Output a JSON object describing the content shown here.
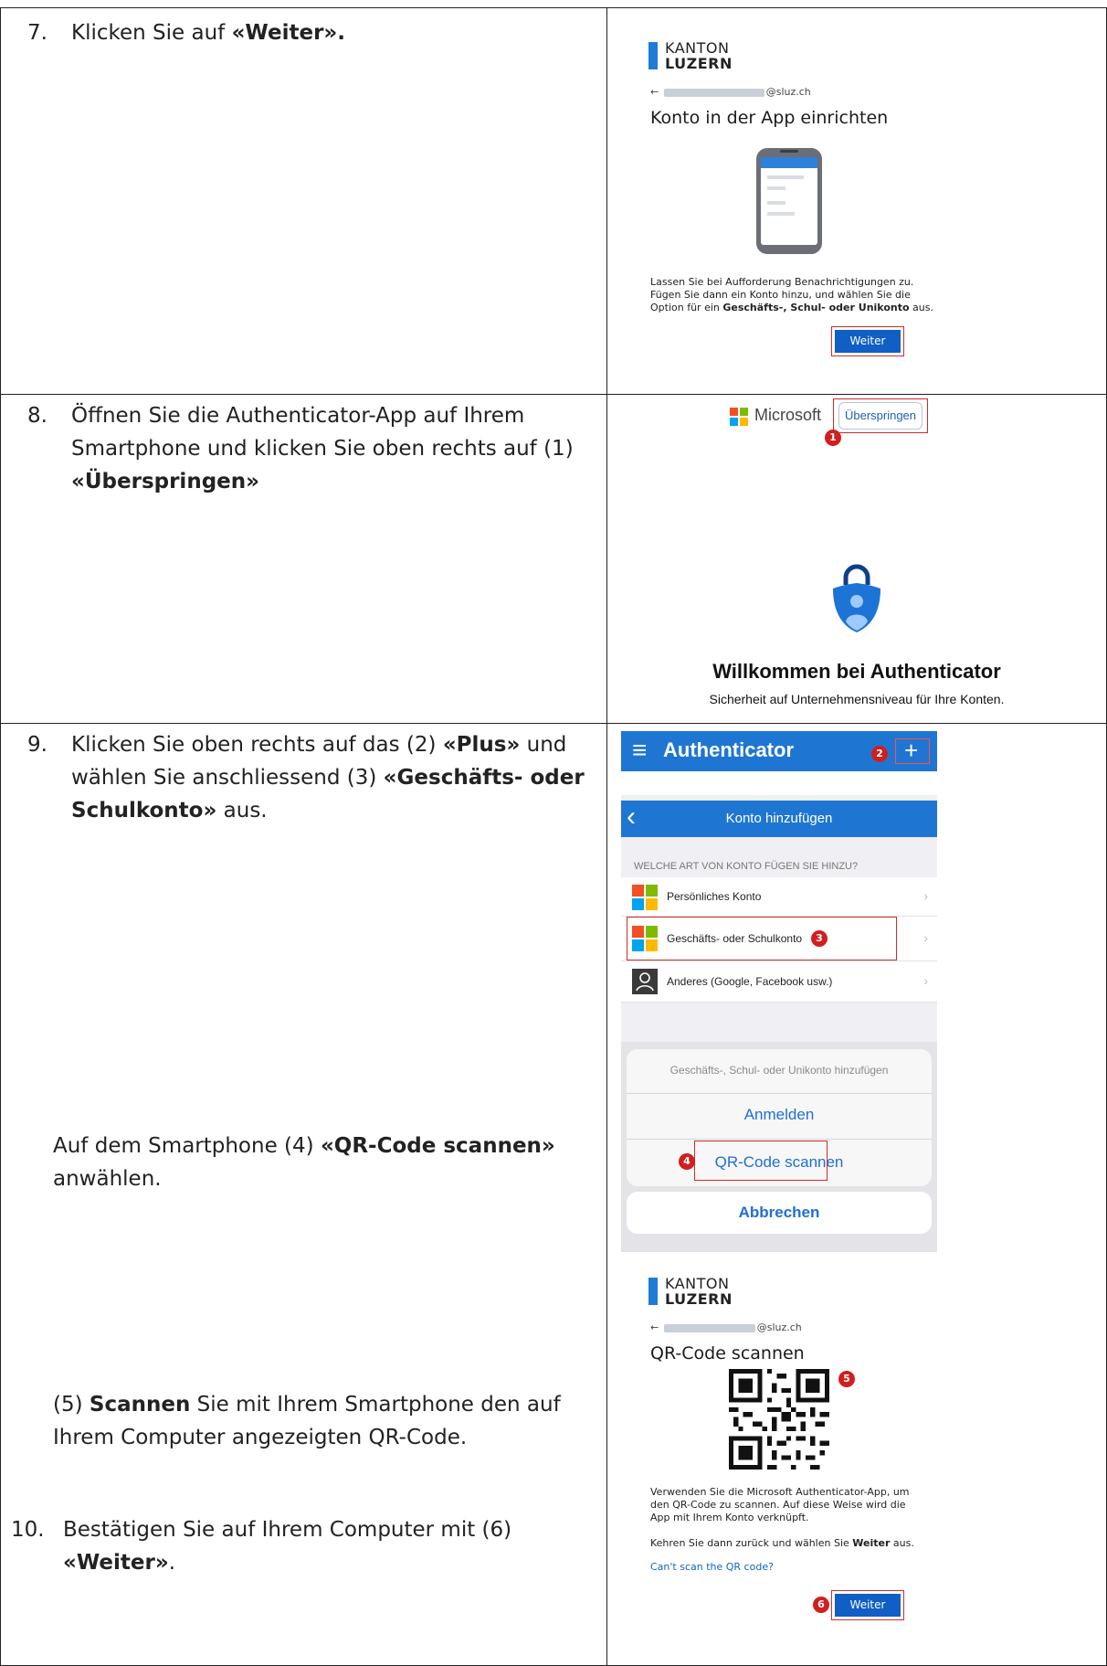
{
  "rows": [
    {
      "number": "7.",
      "text_prefix": "Klicken Sie auf ",
      "text_bold": "«Weiter».",
      "panel": {
        "org_line1": "KANTON",
        "org_line2": "LUZERN",
        "back_arrow": "←",
        "email_suffix": "@sluz.ch",
        "title": "Konto in der App einrichten",
        "body_line1": "Lassen Sie bei Aufforderung Benachrichtigungen zu.",
        "body_line2": "Fügen Sie dann ein Konto hinzu, und wählen Sie die",
        "body_line3_prefix": "Option für ein ",
        "body_line3_bold": "Geschäfts-, Schul- oder Unikonto",
        "body_line3_suffix": " aus.",
        "button": "Weiter"
      }
    },
    {
      "number": "8.",
      "line1": "Öffnen Sie die Authenticator-App auf Ihrem",
      "line2": "Smartphone und klicken Sie oben rechts auf (1)",
      "line3_bold": "«Überspringen»",
      "panel": {
        "brand": "Microsoft",
        "skip_button": "Überspringen",
        "badge": "1",
        "welcome_title": "Willkommen bei Authenticator",
        "welcome_sub": "Sicherheit auf Unternehmensniveau für Ihre Konten."
      }
    },
    {
      "number": "9.",
      "line1_prefix": "Klicken Sie oben rechts auf das (2) ",
      "line1_bold": "«Plus»",
      "line1_suffix": " und",
      "line2_prefix": "wählen Sie anschliessend (3) ",
      "line2_bold": "«Geschäfts- oder",
      "line3_bold": "Schulkonto»",
      "line3_suffix": " aus.",
      "sub1_line1_prefix": "Auf dem Smartphone (4) ",
      "sub1_line1_bold": "«QR-Code scannen»",
      "sub1_line2": "anwählen.",
      "sub2_line1_prefix": "(5) ",
      "sub2_line1_bold": "Scannen",
      "sub2_line1_suffix": " Sie mit Ihrem Smartphone den auf",
      "sub2_line2": "Ihrem Computer angezeigten QR-Code.",
      "app": {
        "menu_icon": "≡",
        "title": "Authenticator",
        "plus": "+",
        "badge2": "2",
        "nav_title": "Konto hinzufügen",
        "back": "‹",
        "section_header": "WELCHE ART VON KONTO FÜGEN SIE HINZU?",
        "items": [
          {
            "label": "Persönliches Konto"
          },
          {
            "label": "Geschäfts- oder Schulkonto"
          },
          {
            "label": "Anderes (Google, Facebook usw.)"
          }
        ],
        "badge3": "3",
        "chevron": "›",
        "sheet_title": "Geschäfts-, Schul- oder Unikonto hinzufügen",
        "sheet_login": "Anmelden",
        "sheet_scan": "QR-Code scannen",
        "badge4": "4",
        "cancel": "Abbrechen"
      },
      "qr_panel": {
        "org_line1": "KANTON",
        "org_line2": "LUZERN",
        "back_arrow": "←",
        "email_suffix": "@sluz.ch",
        "title": "QR-Code scannen",
        "badge5": "5",
        "body_line1": "Verwenden Sie die Microsoft Authenticator-App, um",
        "body_line2": "den QR-Code zu scannen. Auf diese Weise wird die",
        "body_line3": "App mit Ihrem Konto verknüpft.",
        "return_prefix": "Kehren Sie dann zurück und wählen Sie ",
        "return_bold": "Weiter",
        "return_suffix": " aus.",
        "cant_scan": "Can't scan the QR code?",
        "badge6": "6",
        "button": "Weiter"
      }
    },
    {
      "number": "10.",
      "line1": "Bestätigen Sie auf Ihrem Computer mit (6)",
      "line2_bold": "«Weiter»",
      "line2_suffix": "."
    }
  ],
  "colors": {
    "brand_blue": "#1f76d2",
    "button_blue": "#0f5fc5",
    "highlight_red": "#d32a2a",
    "badge_red": "#d11f1f"
  }
}
